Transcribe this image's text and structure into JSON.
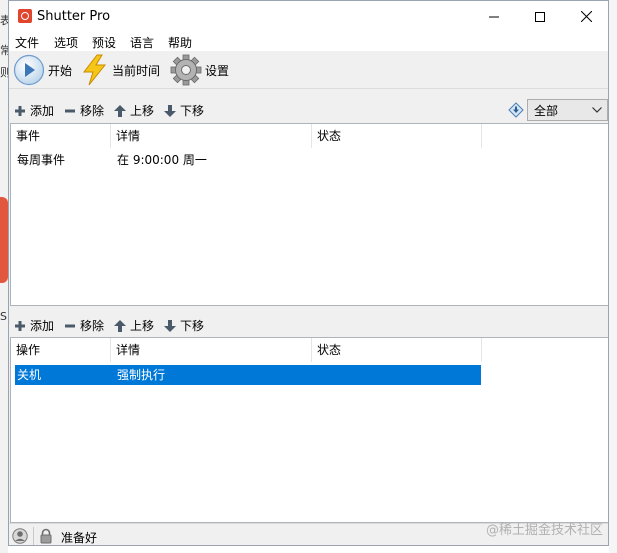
{
  "background": {
    "fragments": [
      "表",
      "常",
      "则",
      "S"
    ]
  },
  "window": {
    "title": "Shutter Pro",
    "controls": [
      "minimize",
      "maximize",
      "close"
    ]
  },
  "menu": [
    "文件",
    "选项",
    "预设",
    "语言",
    "帮助"
  ],
  "toolbar": {
    "start": "开始",
    "current_time": "当前时间",
    "settings": "设置"
  },
  "events_toolbar": {
    "add": "添加",
    "remove": "移除",
    "move_up": "上移",
    "move_down": "下移",
    "filter_value": "全部"
  },
  "events_table": {
    "columns": [
      "事件",
      "详情",
      "状态"
    ],
    "rows": [
      {
        "event": "每周事件",
        "detail": "在 9:00:00 周一",
        "status": ""
      }
    ]
  },
  "actions_toolbar": {
    "add": "添加",
    "remove": "移除",
    "move_up": "上移",
    "move_down": "下移"
  },
  "actions_table": {
    "columns": [
      "操作",
      "详情",
      "状态"
    ],
    "rows": [
      {
        "action": "关机",
        "detail": "强制执行",
        "status": "",
        "selected": true
      }
    ]
  },
  "status_bar": {
    "text": "准备好"
  },
  "watermark": "@稀土掘金技术社区",
  "colors": {
    "selection": "#0078d7",
    "accent_icon": "#e0452e"
  }
}
